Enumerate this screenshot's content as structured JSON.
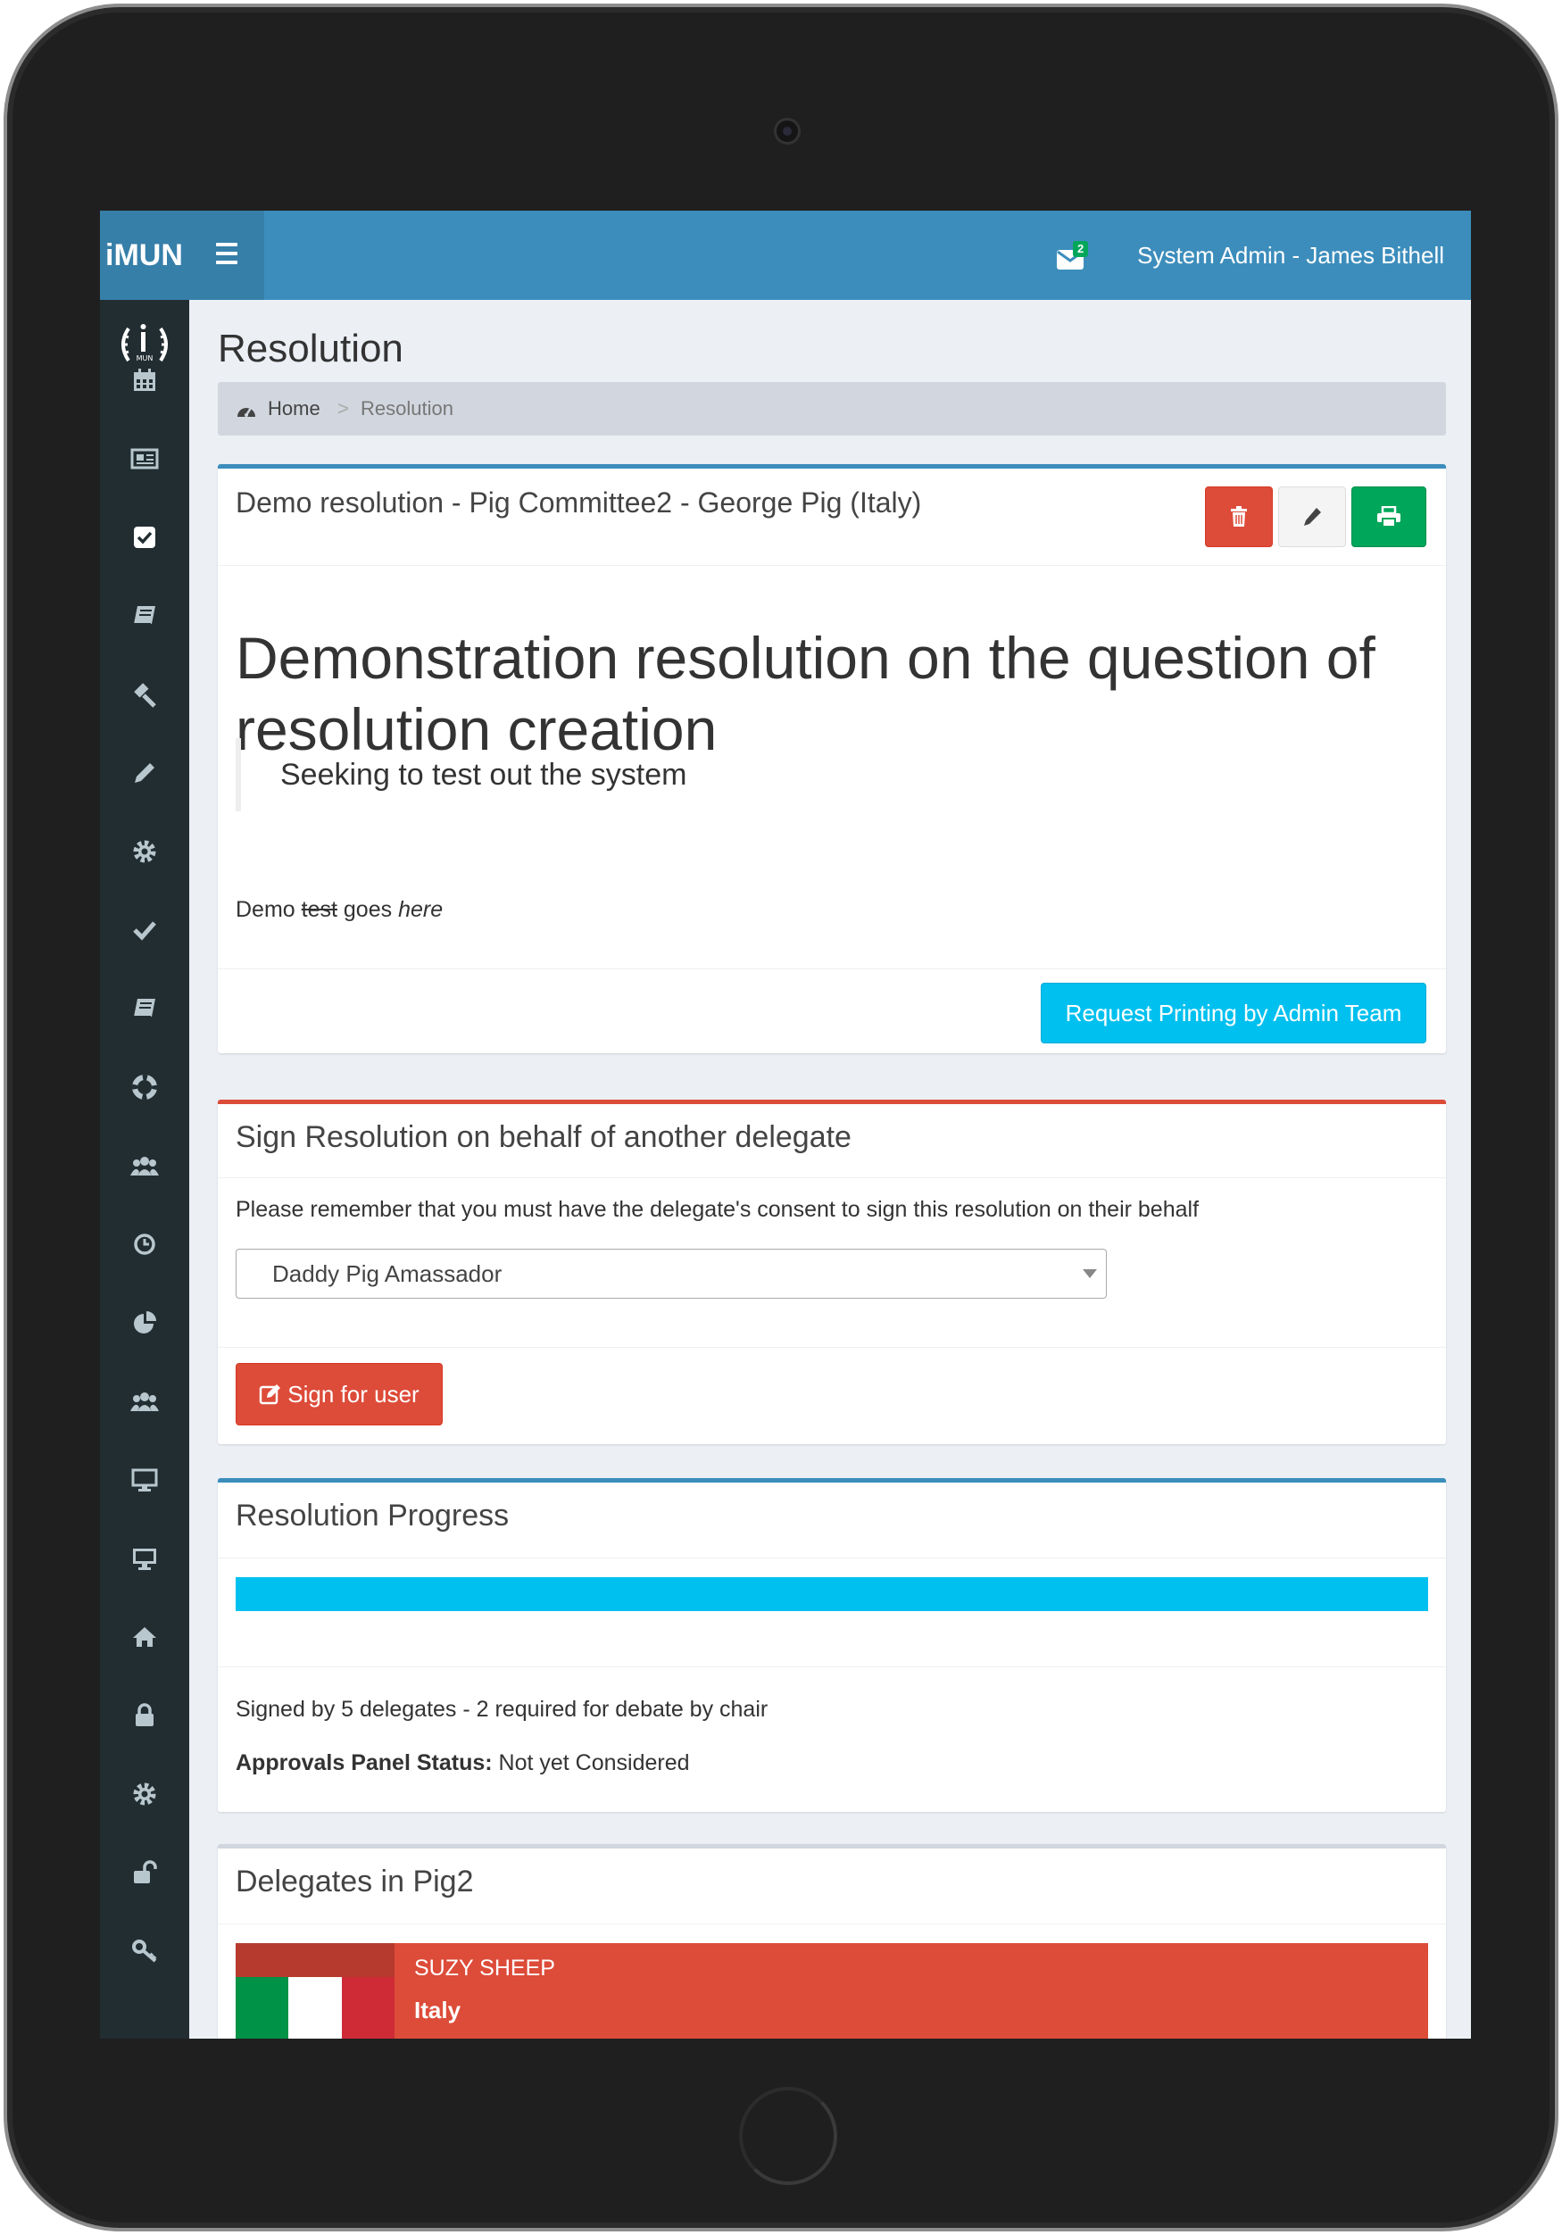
{
  "app": {
    "logo": "iMUN",
    "user": "System Admin - James Bithell",
    "mail_count": "2"
  },
  "sidebar": {
    "icons": [
      "calendar-icon",
      "newspaper-icon",
      "check-square-icon",
      "book-icon",
      "gavel-icon",
      "pencil-icon",
      "cog-icon",
      "check-icon",
      "book-icon",
      "life-ring-icon",
      "users-icon",
      "clock-icon",
      "pie-chart-icon",
      "users-icon",
      "desktop-icon",
      "desktop-icon",
      "home-icon",
      "lock-icon",
      "cog-icon",
      "unlock-icon",
      "key-icon"
    ]
  },
  "page": {
    "title": "Resolution"
  },
  "breadcrumb": {
    "home": "Home",
    "separator": ">",
    "current": "Resolution"
  },
  "resolution": {
    "header": "Demo resolution - Pig Committee2 - George Pig (Italy)",
    "heading": "Demonstration resolution on the question of resolution creation",
    "quote": "Seeking to test out the system",
    "body_pre": "Demo",
    "body_struck": "test",
    "body_mid": "goes",
    "body_em": "here",
    "print_request_label": "Request Printing by Admin Team"
  },
  "sign": {
    "title": "Sign Resolution on behalf of another delegate",
    "note": "Please remember that you must have the delegate's consent to sign this resolution on their behalf",
    "selected": "Daddy Pig Amassador",
    "button": "Sign for user"
  },
  "progress": {
    "title": "Resolution Progress",
    "fill_percent": 100,
    "signed_text": "Signed by 5 delegates - 2 required for debate by chair",
    "status_label": "Approvals Panel Status:",
    "status_value": "Not yet Considered"
  },
  "delegates": {
    "title": "Delegates in Pig2",
    "list": [
      {
        "name": "SUZY SHEEP",
        "country": "Italy"
      }
    ]
  },
  "colors": {
    "topbar": "#3c8dbc",
    "sidebar": "#222d32",
    "danger": "#dd4b39",
    "success": "#00a65a",
    "info": "#00c0ef"
  }
}
